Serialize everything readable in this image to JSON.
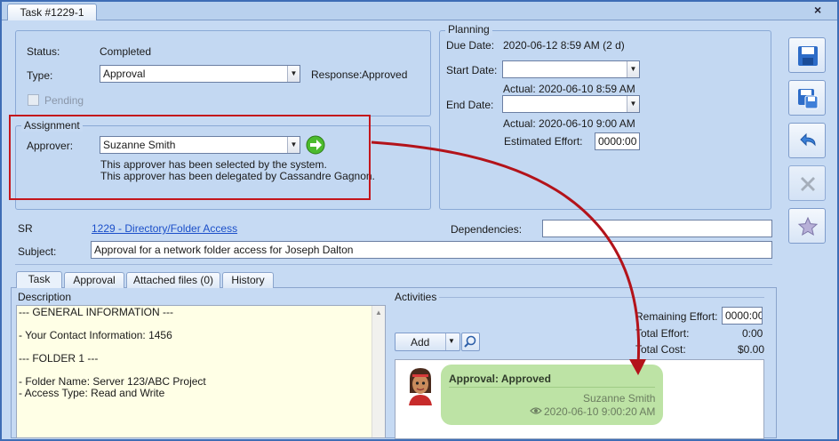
{
  "window": {
    "tab_title": "Task #1229-1",
    "close_label": "×"
  },
  "status": {
    "label": "Status:",
    "value": "Completed"
  },
  "type": {
    "label": "Type:",
    "value": "Approval"
  },
  "response": {
    "label": "Response:",
    "value": "Approved"
  },
  "pending": {
    "label": "Pending",
    "checked": false
  },
  "assignment": {
    "legend": "Assignment",
    "approver_label": "Approver:",
    "approver_value": "Suzanne Smith",
    "note1": "This approver has been selected by the system.",
    "note2": "This approver has been delegated by Cassandre Gagnon."
  },
  "planning": {
    "legend": "Planning",
    "due_label": "Due Date:",
    "due_value": "2020-06-12 8:59 AM (2 d)",
    "start_label": "Start Date:",
    "start_value": "",
    "start_actual": "Actual:   2020-06-10 8:59 AM",
    "end_label": "End Date:",
    "end_value": "",
    "end_actual": "Actual:   2020-06-10 9:00 AM",
    "effort_label": "Estimated Effort:",
    "effort_value": "0000:00"
  },
  "sr": {
    "label": "SR",
    "link": "1229 - Directory/Folder Access"
  },
  "dependencies": {
    "label": "Dependencies:",
    "value": ""
  },
  "subject": {
    "label": "Subject:",
    "value": "Approval for a network folder access for Joseph Dalton"
  },
  "tabs": [
    {
      "label": "Task",
      "active": true
    },
    {
      "label": "Approval",
      "active": false
    },
    {
      "label": "Attached files (0)",
      "active": false
    },
    {
      "label": "History",
      "active": false
    }
  ],
  "description": {
    "label": "Description",
    "text": "--- GENERAL INFORMATION ---\n\n- Your Contact Information: 1456\n\n--- FOLDER 1 ---\n\n- Folder Name: Server 123/ABC Project\n- Access Type: Read and Write"
  },
  "activities": {
    "label": "Activities",
    "add_label": "Add",
    "remaining_label": "Remaining Effort:",
    "remaining_value": "0000:00",
    "total_effort_label": "Total Effort:",
    "total_effort_value": "0:00",
    "total_cost_label": "Total Cost:",
    "total_cost_value": "$0.00",
    "item": {
      "title": "Approval: Approved",
      "author": "Suzanne Smith",
      "timestamp": "2020-06-10 9:00:20 AM"
    }
  },
  "colors": {
    "highlight_box": "#c4161c",
    "arrow": "#b3131a",
    "bubble": "#bde3a5"
  },
  "icons": [
    "save-icon",
    "save-close-icon",
    "undo-icon",
    "delete-icon",
    "favorite-star-icon",
    "go-arrow-icon",
    "search-icon",
    "eye-icon",
    "avatar-icon"
  ]
}
